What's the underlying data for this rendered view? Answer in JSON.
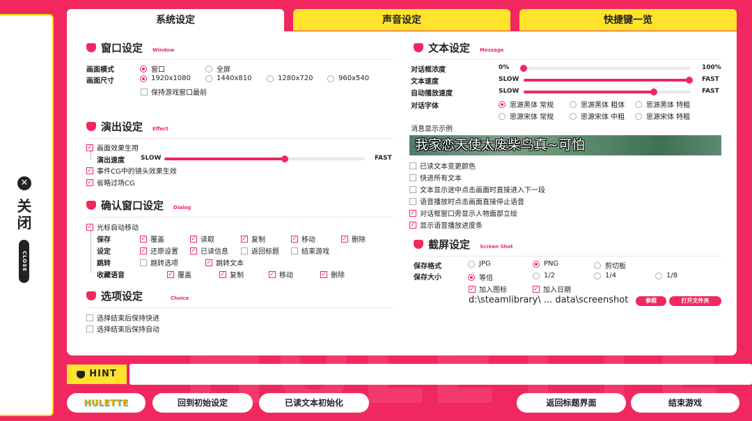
{
  "close": {
    "label_cn": "关闭",
    "label_en": "CLOSE"
  },
  "tabs": [
    {
      "label": "系统设定",
      "active": true
    },
    {
      "label": "声音设定",
      "active": false
    },
    {
      "label": "快捷键一览",
      "active": false
    }
  ],
  "window_settings": {
    "title": "窗口设定",
    "subtitle": "Window",
    "mode_label": "画面模式",
    "size_label": "画面尺寸",
    "modes": [
      {
        "label": "窗口",
        "selected": true
      },
      {
        "label": "全屏",
        "selected": false
      }
    ],
    "sizes": [
      {
        "label": "1920x1080",
        "selected": true
      },
      {
        "label": "1440x810",
        "selected": false
      },
      {
        "label": "1280x720",
        "selected": false
      },
      {
        "label": "960x540",
        "selected": false
      }
    ],
    "keep_front": {
      "label": "保持游戏窗口最前",
      "checked": false
    }
  },
  "effect_settings": {
    "title": "演出设定",
    "subtitle": "Effect",
    "screen_effect": {
      "label": "画面效果生用",
      "checked": true
    },
    "speed_label": "演出速度",
    "slow": "SLOW",
    "fast": "FAST",
    "speed_level": 0.6,
    "cg_lens": {
      "label": "事件CG中的镜头效果生效",
      "checked": true
    },
    "skip_cg": {
      "label": "省略过场CG",
      "checked": true
    }
  },
  "dialog_settings": {
    "title": "确认窗口设定",
    "subtitle": "Dialog",
    "cursor_auto": {
      "label": "光标自动移动",
      "checked": true
    },
    "rows": [
      {
        "label": "保存",
        "items": [
          {
            "label": "覆盖",
            "checked": true
          },
          {
            "label": "读取",
            "checked": true
          },
          {
            "label": "复制",
            "checked": true
          },
          {
            "label": "移动",
            "checked": true
          },
          {
            "label": "删除",
            "checked": true
          }
        ]
      },
      {
        "label": "设定",
        "items": [
          {
            "label": "还原设置",
            "checked": true
          },
          {
            "label": "已读信息",
            "checked": true
          },
          {
            "label": "返回标题",
            "checked": false
          },
          {
            "label": "结束游戏",
            "checked": false
          }
        ]
      },
      {
        "label": "跳转",
        "items": [
          {
            "label": "跳转选项",
            "checked": false
          },
          {
            "label": "跳转文本",
            "checked": true
          }
        ]
      },
      {
        "label": "收藏语音",
        "items": [
          {
            "label": "覆盖",
            "checked": true
          },
          {
            "label": "复制",
            "checked": true
          },
          {
            "label": "移动",
            "checked": true
          },
          {
            "label": "删除",
            "checked": true
          }
        ]
      }
    ]
  },
  "choice_settings": {
    "title": "选项设定",
    "subtitle": "Choice",
    "keep_skip": {
      "label": "选择结束后保持快进",
      "checked": false
    },
    "keep_auto": {
      "label": "选择结束后保持自动",
      "checked": false
    }
  },
  "text_settings": {
    "title": "文本设定",
    "subtitle": "Message",
    "opacity": {
      "label": "对话框浓度",
      "min": "0%",
      "max": "100%",
      "level": 0.0
    },
    "text_speed": {
      "label": "文本速度",
      "min": "SLOW",
      "max": "FAST",
      "level": 0.99
    },
    "auto_speed": {
      "label": "自动播放速度",
      "min": "SLOW",
      "max": "FAST",
      "level": 0.78
    },
    "font_label": "对话字体",
    "fonts": [
      {
        "label": "思源黑体 常规",
        "selected": true
      },
      {
        "label": "思源黑体 粗体",
        "selected": false
      },
      {
        "label": "思源黑体 特粗",
        "selected": false
      },
      {
        "label": "思源宋体 常规",
        "selected": false
      },
      {
        "label": "思源宋体 中粗",
        "selected": false
      },
      {
        "label": "思源宋体 特粗",
        "selected": false
      }
    ],
    "preview_label": "消息显示示例",
    "preview_text": "我家恋天使太废柴鸟真~可怕",
    "options": [
      {
        "label": "已读文本变更颜色",
        "checked": false
      },
      {
        "label": "快进所有文本",
        "checked": false
      },
      {
        "label": "文本显示途中点击画面时直接进入下一段",
        "checked": false
      },
      {
        "label": "语音播放时点击画面直接停止语音",
        "checked": false
      },
      {
        "label": "对话框窗口旁显示人物面部立绘",
        "checked": true
      },
      {
        "label": "显示语音播放进度条",
        "checked": true
      }
    ]
  },
  "screenshot_settings": {
    "title": "截屏设定",
    "subtitle": "Screen Shot",
    "format_label": "保存格式",
    "size_label": "保存大小",
    "formats": [
      {
        "label": "JPG",
        "selected": false
      },
      {
        "label": "PNG",
        "selected": true
      },
      {
        "label": "剪切板",
        "selected": false
      }
    ],
    "sizes": [
      {
        "label": "等倍",
        "selected": true
      },
      {
        "label": "1/2",
        "selected": false
      },
      {
        "label": "1/4",
        "selected": false
      },
      {
        "label": "1/8",
        "selected": false
      }
    ],
    "add_icon": {
      "label": "加入图标",
      "checked": true
    },
    "add_date": {
      "label": "加入日期",
      "checked": true
    },
    "path": "d:\\steamlibrary\\ ... data\\screenshot",
    "browse_label": "参照",
    "open_folder_label": "打开文件夹"
  },
  "hint": {
    "label": "HINT",
    "text": ""
  },
  "bottom": {
    "logo_text": "HULETTE",
    "reset_label": "回到初始设定",
    "read_reset_label": "已读文本初始化",
    "title_label": "返回标题界面",
    "quit_label": "结束游戏"
  },
  "colors": {
    "accent": "#f0285f",
    "tab_inactive": "#ffe42b",
    "panel": "#ffffff"
  }
}
